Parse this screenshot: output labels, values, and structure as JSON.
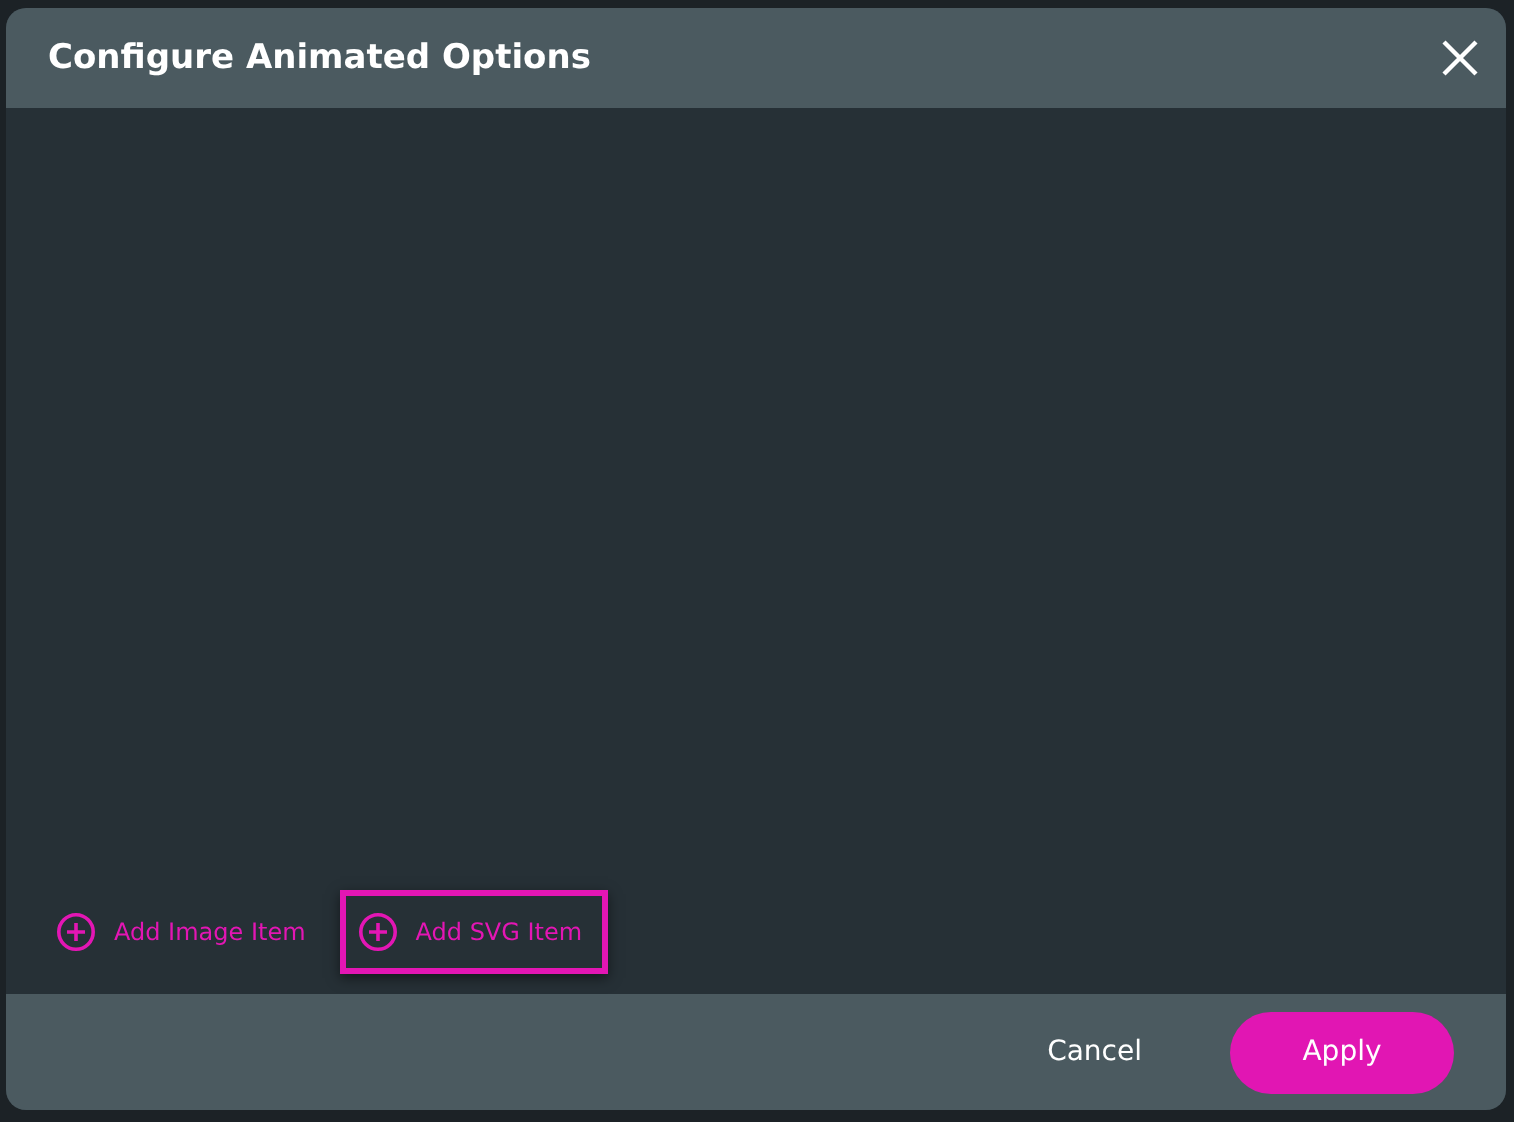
{
  "dialog": {
    "title": "Configure Animated Options"
  },
  "add_items": [
    {
      "label": "Add Image Item",
      "selected": false
    },
    {
      "label": "Add SVG Item",
      "selected": true
    }
  ],
  "buttons": [
    {
      "label": "Cancel",
      "kind": "text"
    },
    {
      "label": "Apply",
      "kind": "primary"
    }
  ]
}
